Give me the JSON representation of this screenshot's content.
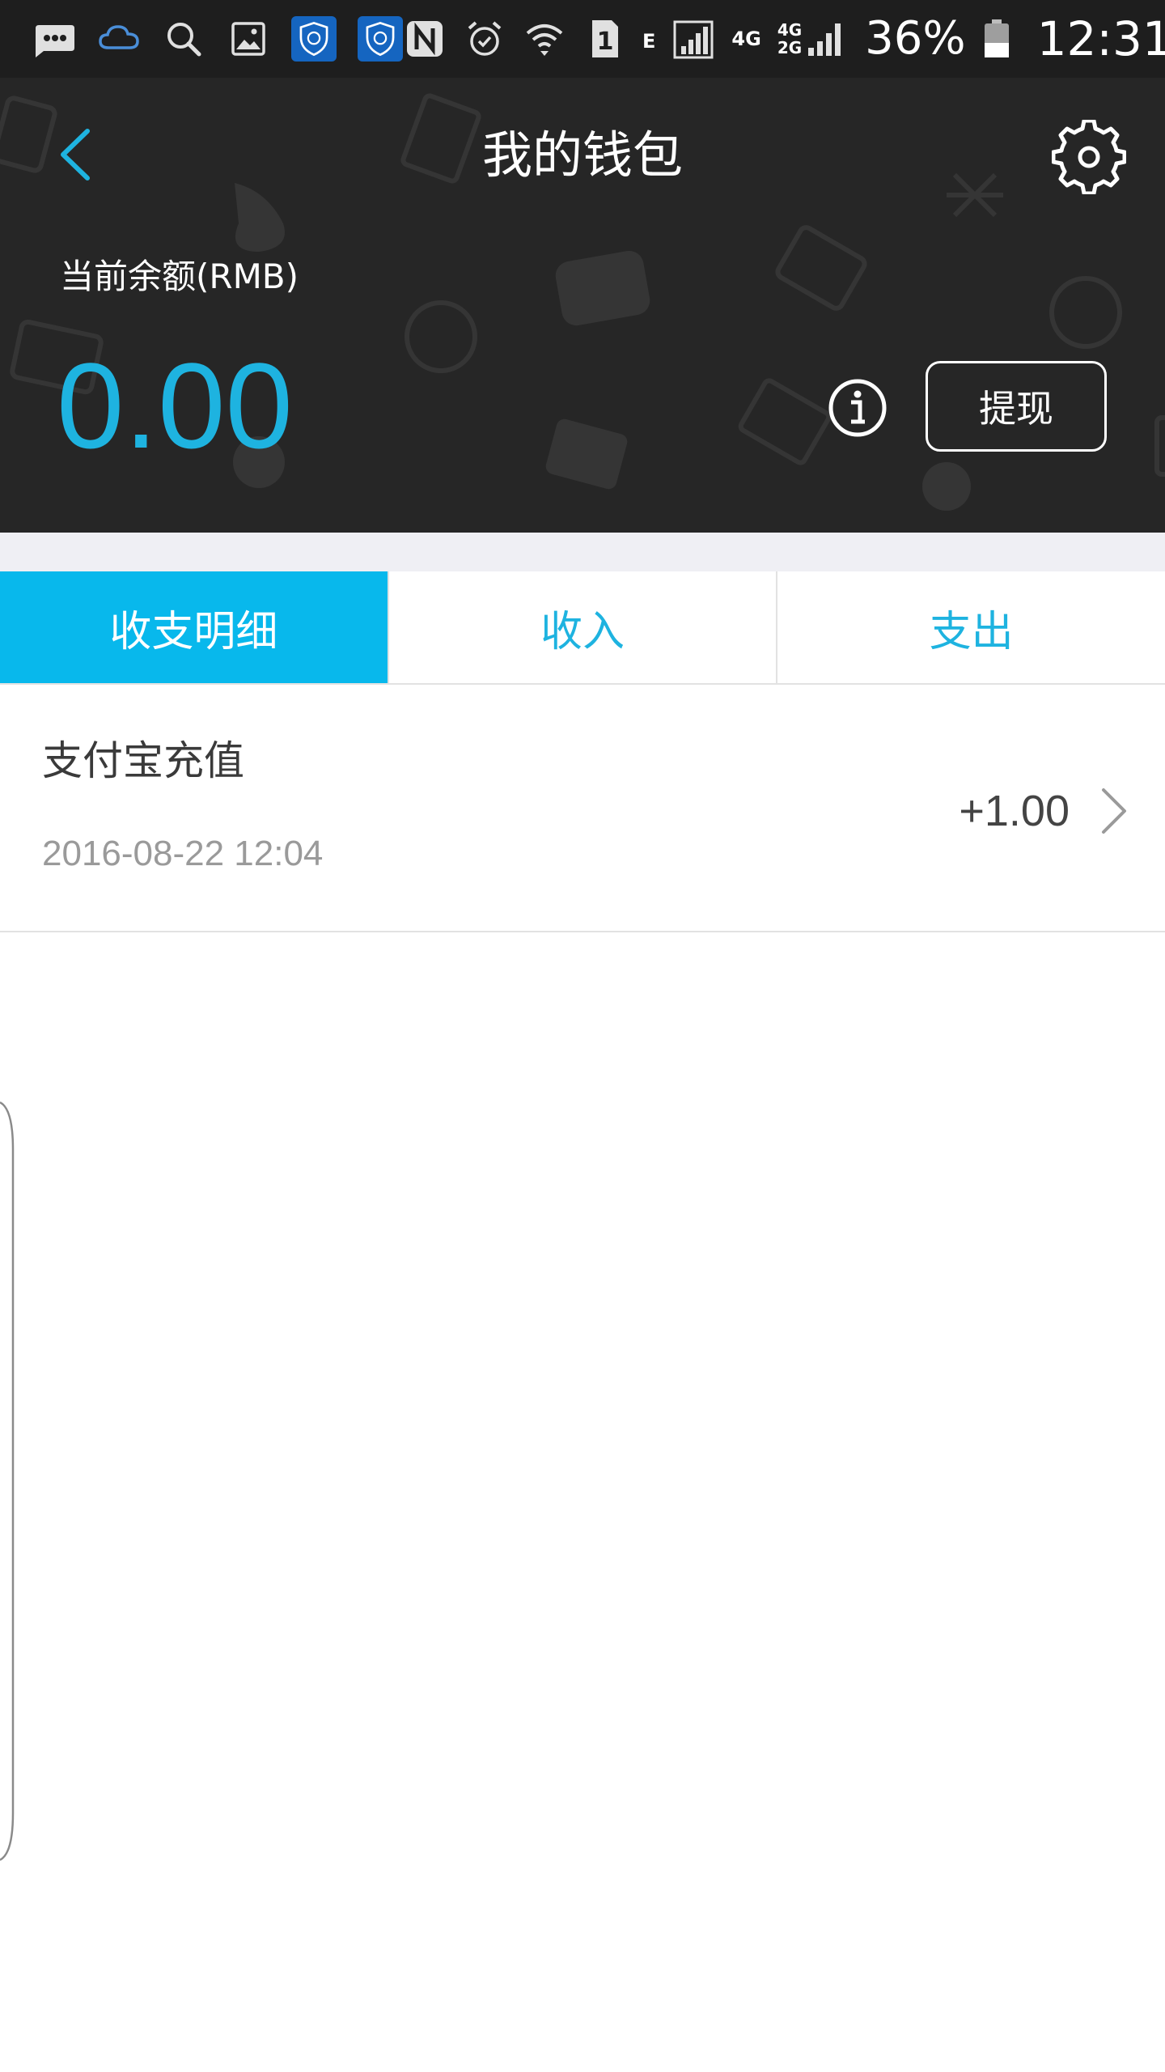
{
  "status_bar": {
    "icons_left": [
      "message-icon",
      "cloud-icon",
      "search-icon",
      "gallery-icon",
      "app-badge-icon",
      "app-badge-icon"
    ],
    "icons_right": [
      "nfc-icon",
      "alarm-icon",
      "wifi-icon",
      "sim-1-icon",
      "e-signal-icon",
      "signal-icon",
      "4g-icon",
      "4g-2g-signal-icon",
      "battery-icon"
    ],
    "network_e": "E",
    "network_4g": "4G",
    "network_4g_top": "4G",
    "network_2g_bottom": "2G",
    "sim_number": "1",
    "battery_percent": "36%",
    "time": "12:31"
  },
  "header": {
    "title": "我的钱包",
    "back_icon": "chevron-left-icon",
    "settings_icon": "gear-icon",
    "balance_label": "当前余额(RMB)",
    "balance_value": "0.00",
    "info_icon": "info-icon",
    "withdraw_label": "提现",
    "accent_color": "#1eb3e0",
    "background_color": "#262626"
  },
  "tabs": [
    {
      "label": "收支明细",
      "active": true
    },
    {
      "label": "收入",
      "active": false
    },
    {
      "label": "支出",
      "active": false
    }
  ],
  "tab_active_color": "#08b8ec",
  "transactions": [
    {
      "title": "支付宝充值",
      "time": "2016-08-22 12:04",
      "amount": "+1.00"
    }
  ]
}
